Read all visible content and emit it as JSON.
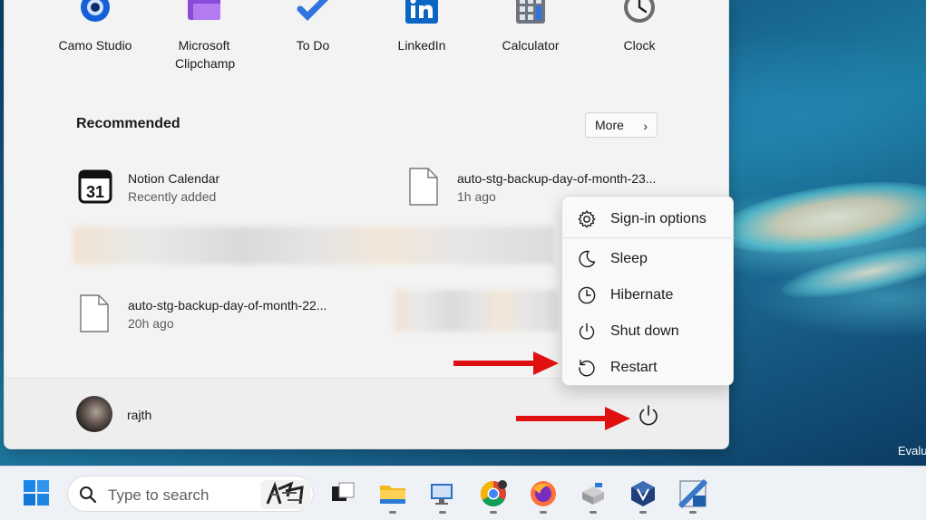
{
  "pinned_apps": [
    {
      "label": "Camo Studio",
      "icon": "camo-studio-icon"
    },
    {
      "label": "Microsoft Clipchamp",
      "icon": "clipchamp-icon"
    },
    {
      "label": "To Do",
      "icon": "todo-icon"
    },
    {
      "label": "LinkedIn",
      "icon": "linkedin-icon"
    },
    {
      "label": "Calculator",
      "icon": "calculator-icon"
    },
    {
      "label": "Clock",
      "icon": "clock-icon"
    }
  ],
  "recommended": {
    "title": "Recommended",
    "more_label": "More",
    "items": [
      {
        "name": "Notion Calendar",
        "sub": "Recently added",
        "icon": "calendar-icon"
      },
      {
        "name": "auto-stg-backup-day-of-month-23...",
        "sub": "1h ago",
        "icon": "file-icon"
      },
      {
        "name": "auto-stg-backup-day-of-month-22...",
        "sub": "20h ago",
        "icon": "file-icon"
      }
    ]
  },
  "user": {
    "name": "rajth"
  },
  "power_menu": {
    "items": [
      {
        "label": "Sign-in options",
        "icon": "gear-icon"
      },
      {
        "label": "Sleep",
        "icon": "moon-icon"
      },
      {
        "label": "Hibernate",
        "icon": "clock-icon"
      },
      {
        "label": "Shut down",
        "icon": "power-icon"
      },
      {
        "label": "Restart",
        "icon": "restart-icon"
      }
    ]
  },
  "taskbar": {
    "search_placeholder": "Type to search",
    "apps": [
      "task-view-icon",
      "file-explorer-icon",
      "remote-desktop-icon",
      "chrome-icon",
      "firefox-icon",
      "drive-tool-icon",
      "virtualbox-icon",
      "win11-iso-icon"
    ]
  },
  "desktop": {
    "watermark": "Evalu"
  },
  "colors": {
    "accent": "#0067c0",
    "annotation_arrow": "#e01010"
  }
}
